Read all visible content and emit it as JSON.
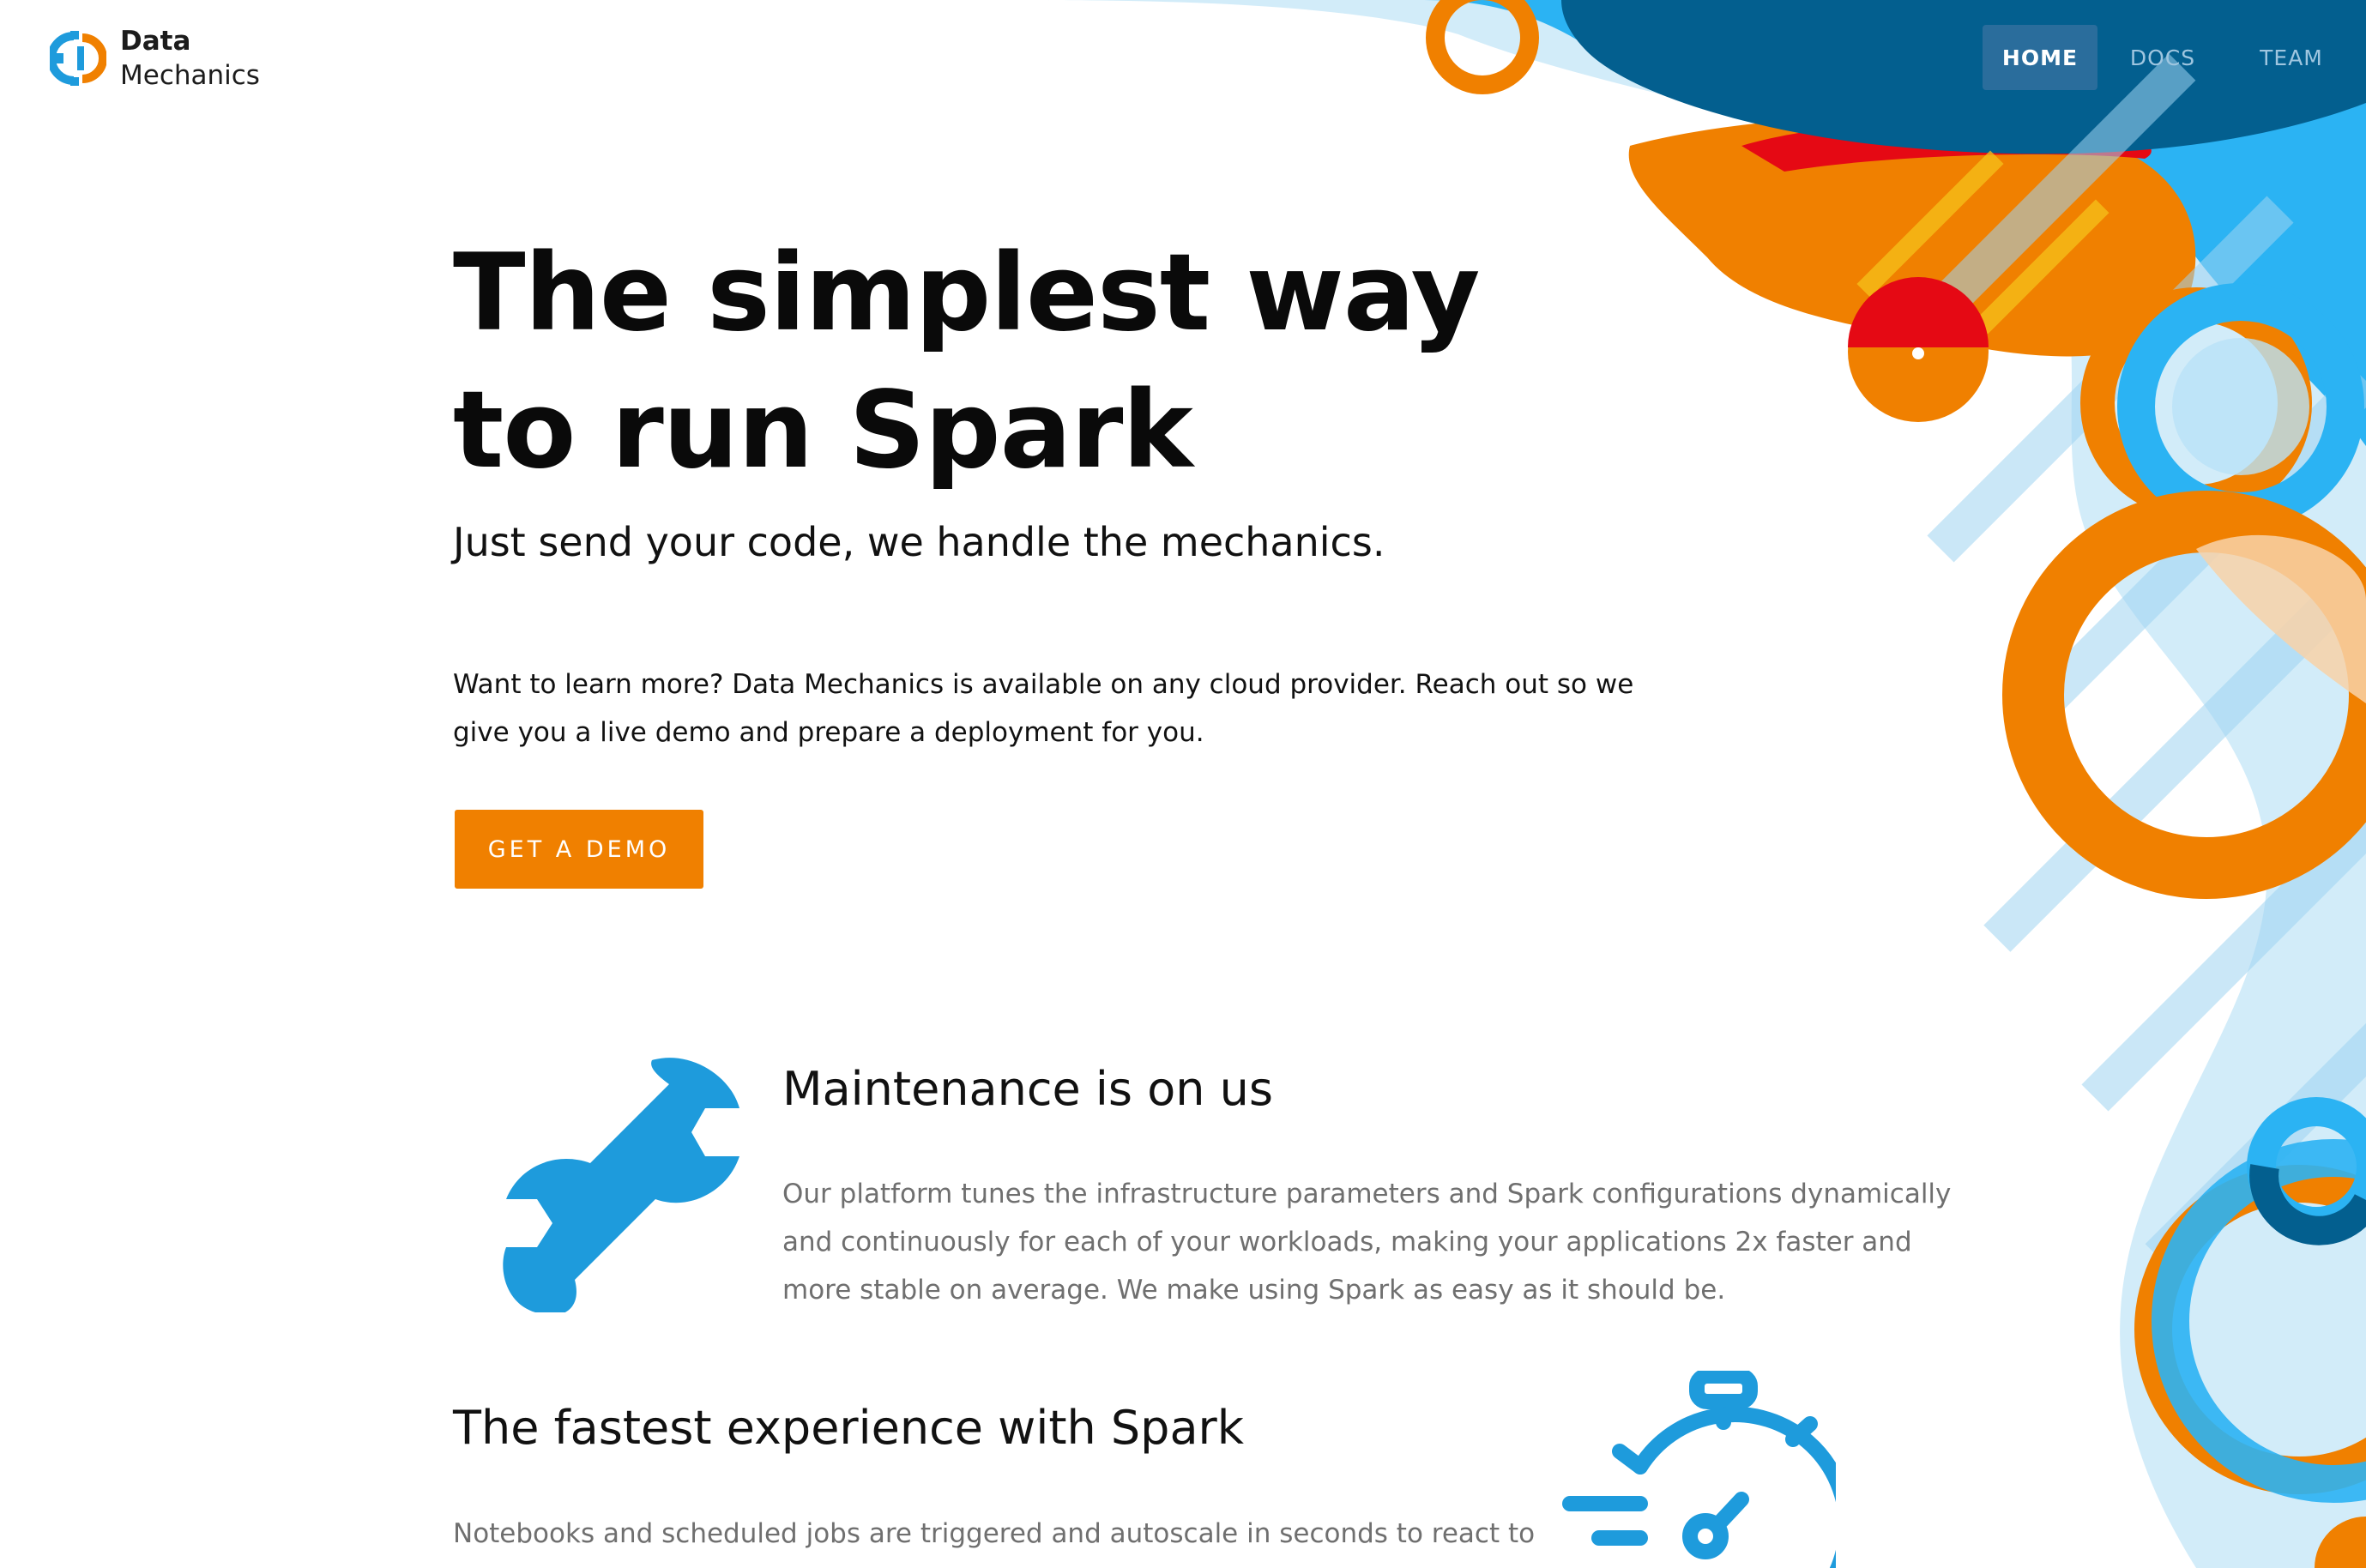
{
  "brand": {
    "name_line1": "Data",
    "name_line2": "Mechanics",
    "logo_icon": "gear-logo-icon",
    "colors": {
      "blue": "#1e9bdc",
      "orange": "#f08000"
    }
  },
  "nav": {
    "items": [
      {
        "label": "HOME",
        "active": true
      },
      {
        "label": "DOCS",
        "active": false
      },
      {
        "label": "TEAM",
        "active": false
      }
    ]
  },
  "hero": {
    "title_line1": "The simplest way",
    "title_line2": "to run Spark",
    "subtitle": "Just send your code, we handle the mechanics.",
    "body_line1": "Want to learn more? Data Mechanics is available on any cloud provider.  Reach out so we",
    "body_line2": "give you a live demo and prepare a deployment for you.",
    "cta_label": "GET A DEMO"
  },
  "features": [
    {
      "icon": "wrench-icon",
      "title": "Maintenance is on us",
      "desc_line1": "Our platform tunes the infrastructure parameters and Spark configurations dynamically",
      "desc_line2": "and continuously for each of your workloads, making your applications 2x faster and",
      "desc_line3": "more stable on average. We make using Spark as easy as it should be."
    },
    {
      "icon": "stopwatch-icon",
      "title": "The fastest experience with Spark",
      "desc_line1": "Notebooks and scheduled jobs are triggered and autoscale in seconds to react to"
    }
  ],
  "theme": {
    "accent_orange": "#f08000",
    "accent_blue": "#1e9bdc",
    "nav_active_bg": "#2a6d9c",
    "dark_blue": "#035f8f",
    "red": "#e50914"
  }
}
